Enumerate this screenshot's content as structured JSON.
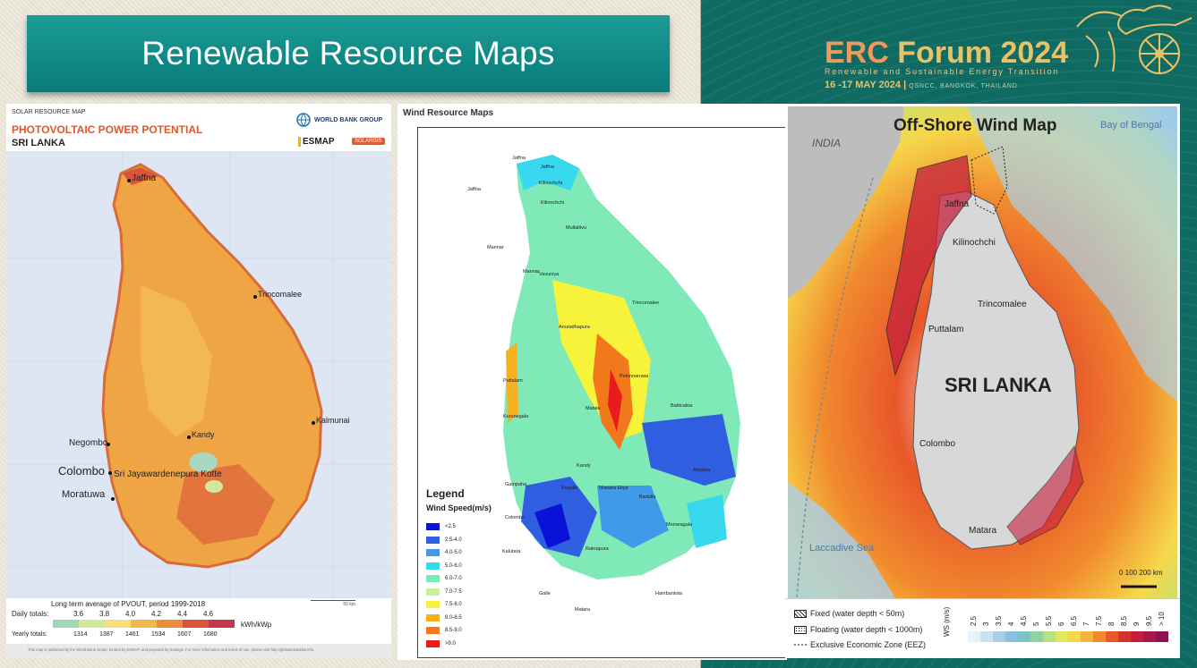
{
  "slide": {
    "title": "Renewable Resource Maps"
  },
  "brand": {
    "title_word1": "ERC",
    "title_word2": "Forum 2024",
    "subtitle": "Renewable and Sustainable Energy Transition",
    "date": "16 -17 MAY 2024",
    "venue": "QSNCC, BANGKOK, THAILAND"
  },
  "solar_map": {
    "header_small": "SOLAR RESOURCE MAP",
    "header_title": "PHOTOVOLTAIC POWER POTENTIAL",
    "header_country": "SRI LANKA",
    "logo_worldbank": "WORLD BANK GROUP",
    "logo_esmap": "ESMAP",
    "logo_solargis": "SOLARGIS",
    "cities": {
      "jaffna": "Jaffna",
      "trincomalee": "Trincomalee",
      "kalmunai": "Kalmunai",
      "kandy": "Kandy",
      "negombo": "Negombo",
      "colombo": "Colombo",
      "kotte": "Sri Jayawardenepura Kotte",
      "moratuwa": "Moratuwa"
    },
    "legend_title": "Long term average of PVOUT, period 1999-2018",
    "daily_label": "Daily totals:",
    "daily_values": [
      "3.6",
      "3.8",
      "4.0",
      "4.2",
      "4.4",
      "4.6"
    ],
    "yearly_label": "Yearly totals:",
    "yearly_values": [
      "1314",
      "1387",
      "1461",
      "1534",
      "1607",
      "1680"
    ],
    "unit": "kWh/kWp",
    "legend_colors": [
      "#9ed6b8",
      "#cfe89a",
      "#f6e07a",
      "#f2b64a",
      "#ea8d3c",
      "#d9553a",
      "#c23a4a"
    ],
    "scale_label": "50 km",
    "footer": "This map is published by the World Bank Group, funded by ESMAP, and prepared by Solargis. For more information and terms of use, please visit http://globalsolaratlas.info."
  },
  "wind_map": {
    "title": "Wind Resource Maps",
    "legend_title": "Legend",
    "legend_subtitle": "Wind Speed(m/s)",
    "legend_items": [
      {
        "label": "<2.5",
        "color": "#0a12d8"
      },
      {
        "label": "2.5-4.0",
        "color": "#2f5fe0"
      },
      {
        "label": "4.0-5.0",
        "color": "#3f9be8"
      },
      {
        "label": "5.0-6.0",
        "color": "#38d8ee"
      },
      {
        "label": "6.0-7.0",
        "color": "#7fe9b8"
      },
      {
        "label": "7.0-7.5",
        "color": "#c8f29a"
      },
      {
        "label": "7.5-8.0",
        "color": "#f7f23a"
      },
      {
        "label": "8.0-8.5",
        "color": "#f6b21e"
      },
      {
        "label": "8.5-9.0",
        "color": "#f2781c"
      },
      {
        "label": ">9.0",
        "color": "#e81c1c"
      }
    ],
    "places": [
      "Jaffna",
      "Jaffna",
      "Jaffna",
      "Kilinochchi",
      "Kilinochchi",
      "Mullaitivu",
      "Mannar",
      "Mannar",
      "Vavuniya",
      "Trincomalee",
      "Anuradhapura",
      "Puttalam",
      "Polonnaruwa",
      "Kurunegala",
      "Batticaloa",
      "Matale",
      "Kandy",
      "Ampara",
      "Gampaha",
      "Kegalle",
      "Badulla",
      "Nuwara Eliya",
      "Colombo",
      "Monaragala",
      "Kalutara",
      "Ratnapura",
      "Hambantota",
      "Galle",
      "Matara"
    ]
  },
  "offshore_map": {
    "title": "Off-Shore Wind Map",
    "india": "INDIA",
    "bay": "Bay of Bengal",
    "sea": "Laccadive Sea",
    "country": "SRI LANKA",
    "places": {
      "jaffna": "Jaffna",
      "kilinochchi": "Kilinochchi",
      "trincomalee": "Trincomalee",
      "puttalam": "Puttalam",
      "colombo": "Colombo",
      "matara": "Matara"
    },
    "scale_label": "0   100  200 km",
    "legend": {
      "fixed": "Fixed (water depth < 50m)",
      "floating": "Floating (water depth < 1000m)",
      "eez": "Exclusive Economic Zone (EEZ)",
      "ws_label": "WS (m/s)",
      "ws_values": [
        "2.5",
        "3",
        "3.5",
        "4",
        "4.5",
        "5",
        "5.5",
        "6",
        "6.5",
        "7",
        "7.5",
        "8",
        "8.5",
        "9",
        "9.5",
        "> 10"
      ],
      "ws_colors": [
        "#e6f1f8",
        "#c9e2f2",
        "#a9d0ea",
        "#8bbfe3",
        "#7cc3c8",
        "#8fd1a0",
        "#b9e07a",
        "#e2e85a",
        "#f6d84a",
        "#f6b43c",
        "#f18a2e",
        "#e8572a",
        "#d8322c",
        "#c51f3c",
        "#a8184a",
        "#8a1450"
      ]
    }
  }
}
